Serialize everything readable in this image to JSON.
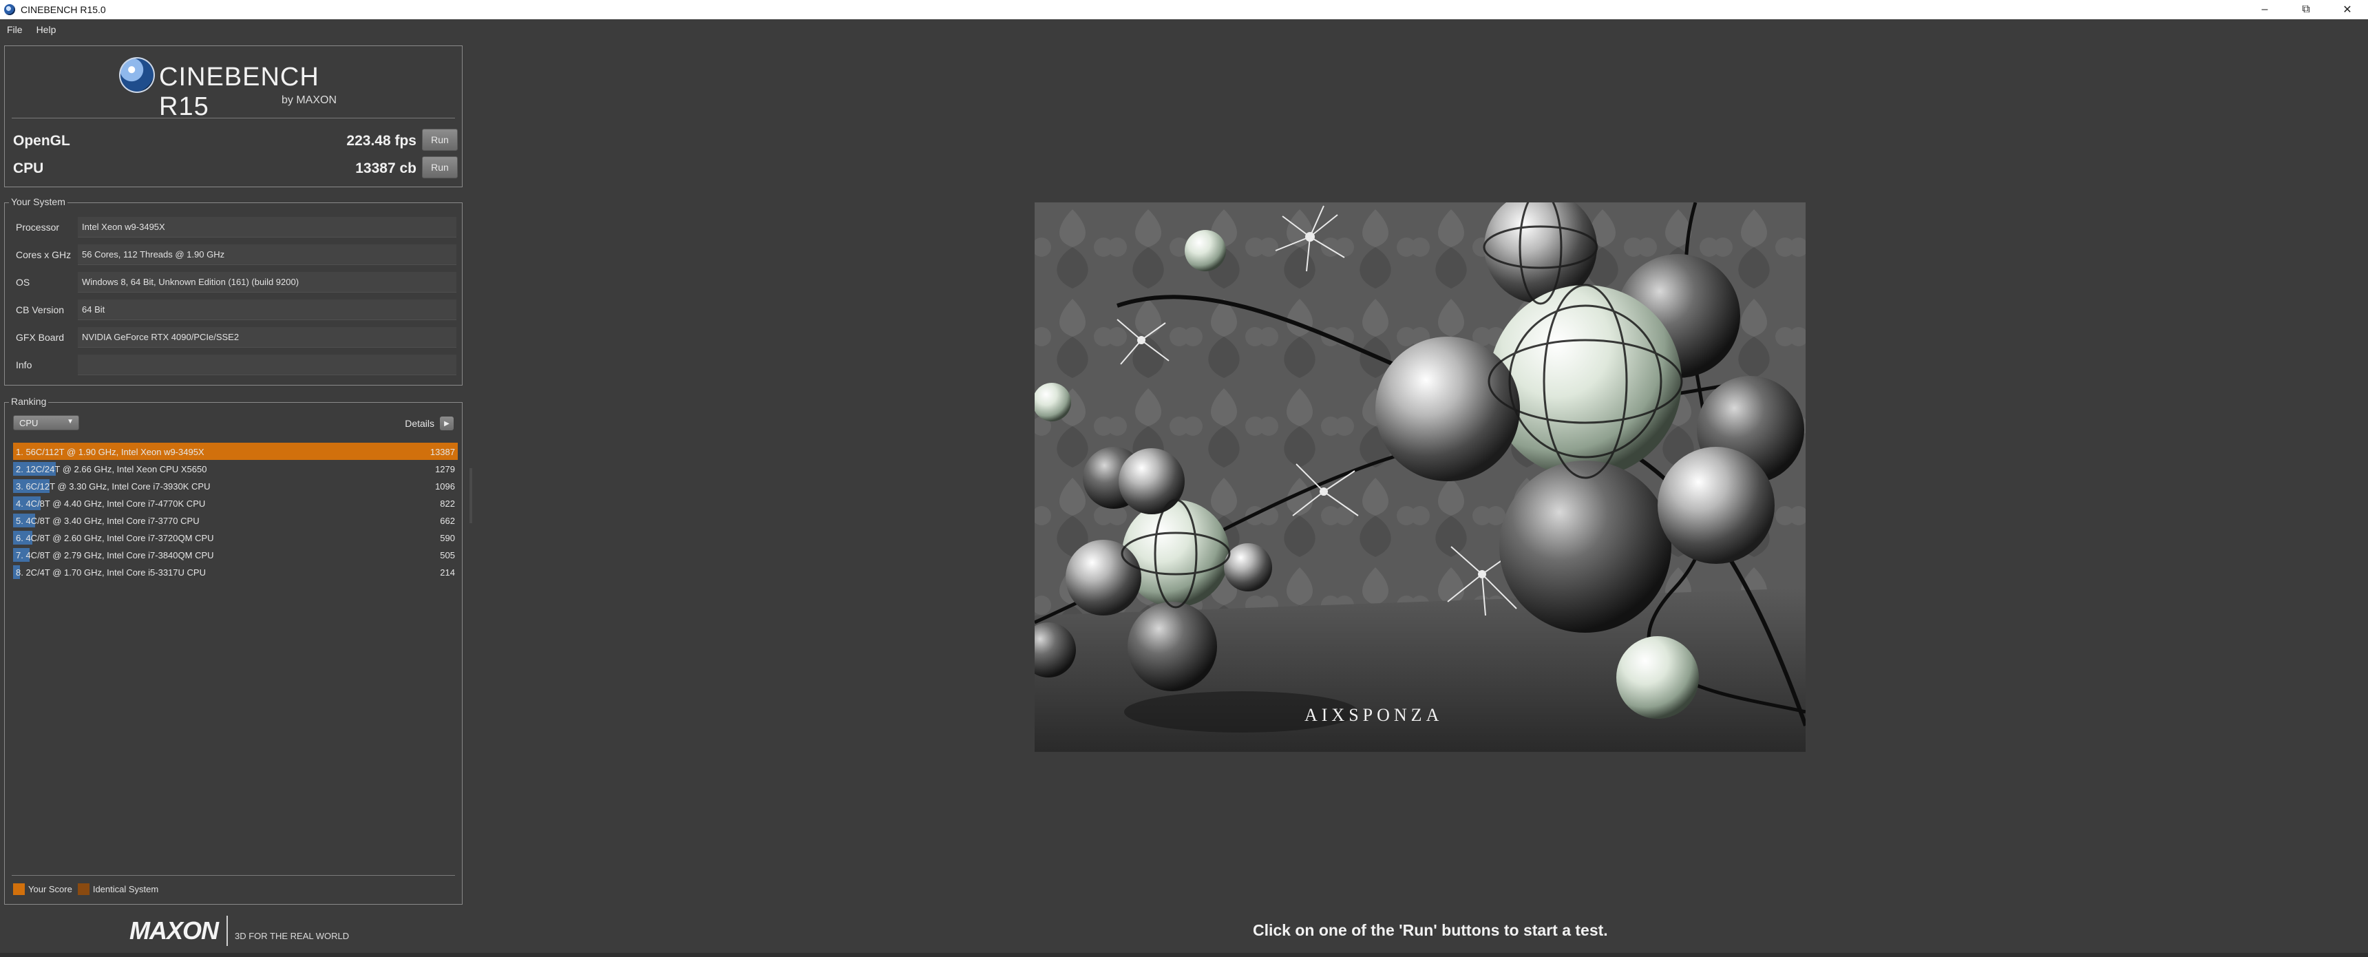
{
  "window": {
    "title": "CINEBENCH R15.0"
  },
  "menu": [
    "File",
    "Help"
  ],
  "logo": {
    "title": "CINEBENCH R15",
    "subtitle": "by MAXON"
  },
  "benchmarks": {
    "opengl": {
      "label": "OpenGL",
      "score": "223.48 fps",
      "run_label": "Run"
    },
    "cpu": {
      "label": "CPU",
      "score": "13387 cb",
      "run_label": "Run"
    }
  },
  "system": {
    "section_title": "Your System",
    "rows": [
      {
        "label": "Processor",
        "value": "Intel Xeon w9-3495X"
      },
      {
        "label": "Cores x GHz",
        "value": "56 Cores, 112 Threads @ 1.90 GHz"
      },
      {
        "label": "OS",
        "value": "Windows 8, 64 Bit, Unknown Edition (161) (build 9200)"
      },
      {
        "label": "CB Version",
        "value": "64 Bit"
      },
      {
        "label": "GFX Board",
        "value": "NVIDIA GeForce RTX 4090/PCIe/SSE2"
      },
      {
        "label": "Info",
        "value": ""
      }
    ]
  },
  "ranking": {
    "section_title": "Ranking",
    "selected_test": "CPU",
    "details_label": "Details",
    "max_score": 13387,
    "rows": [
      {
        "text": "1. 56C/112T @ 1.90 GHz, Intel Xeon w9-3495X",
        "score": 13387,
        "highlight": true
      },
      {
        "text": "2. 12C/24T @ 2.66 GHz, Intel Xeon CPU X5650",
        "score": 1279,
        "highlight": false
      },
      {
        "text": "3. 6C/12T @ 3.30 GHz,  Intel Core i7-3930K CPU",
        "score": 1096,
        "highlight": false
      },
      {
        "text": "4. 4C/8T @ 4.40 GHz, Intel Core i7-4770K CPU",
        "score": 822,
        "highlight": false
      },
      {
        "text": "5. 4C/8T @ 3.40 GHz,  Intel Core i7-3770 CPU",
        "score": 662,
        "highlight": false
      },
      {
        "text": "6. 4C/8T @ 2.60 GHz, Intel Core i7-3720QM CPU",
        "score": 590,
        "highlight": false
      },
      {
        "text": "7. 4C/8T @ 2.79 GHz,  Intel Core i7-3840QM CPU",
        "score": 505,
        "highlight": false
      },
      {
        "text": "8. 2C/4T @ 1.70 GHz,  Intel Core i5-3317U CPU",
        "score": 214,
        "highlight": false
      }
    ],
    "legend": [
      {
        "label": "Your Score",
        "color": "#d1700c"
      },
      {
        "label": "Identical System",
        "color": "#8a4a10"
      }
    ]
  },
  "footer": {
    "brand": "MAXON",
    "tagline": "3D FOR THE REAL WORLD"
  },
  "status_message": "Click on one of the 'Run' buttons to start a test.",
  "render": {
    "watermark": "AIXSPONZA"
  },
  "colors": {
    "background": "#3c3c3c",
    "highlight": "#d1700c",
    "bar": "#3f6fa6"
  }
}
